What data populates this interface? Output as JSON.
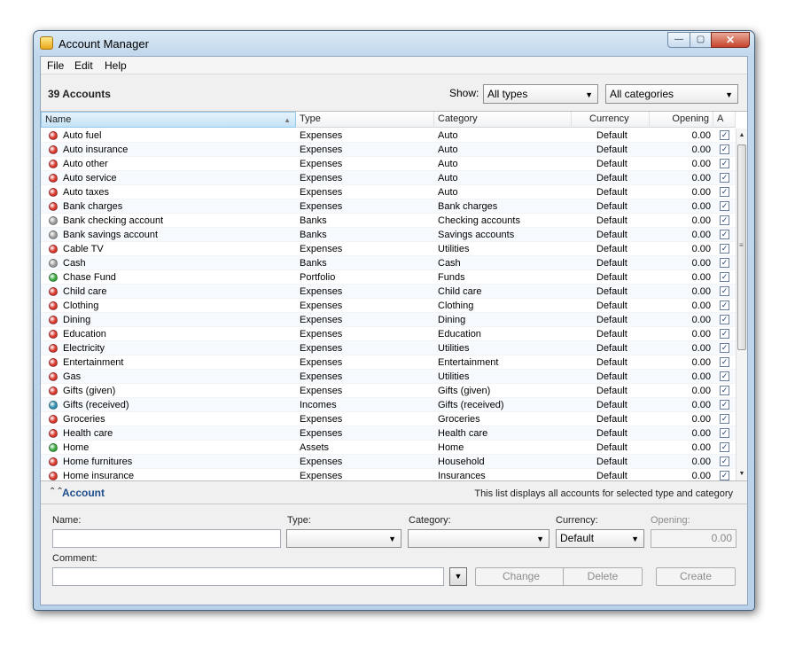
{
  "window": {
    "title": "Account Manager",
    "minimize": "—",
    "maximize": "▢",
    "close": "✕"
  },
  "menu": [
    "File",
    "Edit",
    "Help"
  ],
  "toolbar": {
    "accounts_count": "39 Accounts",
    "show_label": "Show:",
    "type_filter": "All types",
    "category_filter": "All categories"
  },
  "columns": {
    "name": "Name",
    "type": "Type",
    "category": "Category",
    "currency": "Currency",
    "opening": "Opening",
    "active": "A"
  },
  "status_colors": {
    "red": "#d9342c",
    "gray": "#9c9c9c",
    "green": "#35a83c",
    "teal": "#2c8fb0"
  },
  "accounts": [
    {
      "name": "Auto fuel",
      "type": "Expenses",
      "category": "Auto",
      "currency": "Default",
      "opening": "0.00",
      "status": "red"
    },
    {
      "name": "Auto insurance",
      "type": "Expenses",
      "category": "Auto",
      "currency": "Default",
      "opening": "0.00",
      "status": "red"
    },
    {
      "name": "Auto other",
      "type": "Expenses",
      "category": "Auto",
      "currency": "Default",
      "opening": "0.00",
      "status": "red"
    },
    {
      "name": "Auto service",
      "type": "Expenses",
      "category": "Auto",
      "currency": "Default",
      "opening": "0.00",
      "status": "red"
    },
    {
      "name": "Auto taxes",
      "type": "Expenses",
      "category": "Auto",
      "currency": "Default",
      "opening": "0.00",
      "status": "red"
    },
    {
      "name": "Bank charges",
      "type": "Expenses",
      "category": "Bank charges",
      "currency": "Default",
      "opening": "0.00",
      "status": "red"
    },
    {
      "name": "Bank checking account",
      "type": "Banks",
      "category": "Checking accounts",
      "currency": "Default",
      "opening": "0.00",
      "status": "gray"
    },
    {
      "name": "Bank savings account",
      "type": "Banks",
      "category": "Savings accounts",
      "currency": "Default",
      "opening": "0.00",
      "status": "gray"
    },
    {
      "name": "Cable TV",
      "type": "Expenses",
      "category": "Utilities",
      "currency": "Default",
      "opening": "0.00",
      "status": "red"
    },
    {
      "name": "Cash",
      "type": "Banks",
      "category": "Cash",
      "currency": "Default",
      "opening": "0.00",
      "status": "gray"
    },
    {
      "name": "Chase Fund",
      "type": "Portfolio",
      "category": "Funds",
      "currency": "Default",
      "opening": "0.00",
      "status": "green"
    },
    {
      "name": "Child care",
      "type": "Expenses",
      "category": "Child care",
      "currency": "Default",
      "opening": "0.00",
      "status": "red"
    },
    {
      "name": "Clothing",
      "type": "Expenses",
      "category": "Clothing",
      "currency": "Default",
      "opening": "0.00",
      "status": "red"
    },
    {
      "name": "Dining",
      "type": "Expenses",
      "category": "Dining",
      "currency": "Default",
      "opening": "0.00",
      "status": "red"
    },
    {
      "name": "Education",
      "type": "Expenses",
      "category": "Education",
      "currency": "Default",
      "opening": "0.00",
      "status": "red"
    },
    {
      "name": "Electricity",
      "type": "Expenses",
      "category": "Utilities",
      "currency": "Default",
      "opening": "0.00",
      "status": "red"
    },
    {
      "name": "Entertainment",
      "type": "Expenses",
      "category": "Entertainment",
      "currency": "Default",
      "opening": "0.00",
      "status": "red"
    },
    {
      "name": "Gas",
      "type": "Expenses",
      "category": "Utilities",
      "currency": "Default",
      "opening": "0.00",
      "status": "red"
    },
    {
      "name": "Gifts (given)",
      "type": "Expenses",
      "category": "Gifts (given)",
      "currency": "Default",
      "opening": "0.00",
      "status": "red"
    },
    {
      "name": "Gifts (received)",
      "type": "Incomes",
      "category": "Gifts (received)",
      "currency": "Default",
      "opening": "0.00",
      "status": "teal"
    },
    {
      "name": "Groceries",
      "type": "Expenses",
      "category": "Groceries",
      "currency": "Default",
      "opening": "0.00",
      "status": "red"
    },
    {
      "name": "Health care",
      "type": "Expenses",
      "category": "Health care",
      "currency": "Default",
      "opening": "0.00",
      "status": "red"
    },
    {
      "name": "Home",
      "type": "Assets",
      "category": "Home",
      "currency": "Default",
      "opening": "0.00",
      "status": "green"
    },
    {
      "name": "Home furnitures",
      "type": "Expenses",
      "category": "Household",
      "currency": "Default",
      "opening": "0.00",
      "status": "red"
    },
    {
      "name": "Home insurance",
      "type": "Expenses",
      "category": "Insurances",
      "currency": "Default",
      "opening": "0.00",
      "status": "red"
    }
  ],
  "panel": {
    "title": "Account",
    "hint": "This list displays all accounts for selected type and category"
  },
  "form": {
    "name_label": "Name:",
    "name_value": "",
    "type_label": "Type:",
    "type_value": "",
    "category_label": "Category:",
    "category_value": "",
    "currency_label": "Currency:",
    "currency_value": "Default",
    "opening_label": "Opening:",
    "opening_value": "0.00",
    "comment_label": "Comment:",
    "comment_value": ""
  },
  "buttons": {
    "change": "Change",
    "delete": "Delete",
    "create": "Create"
  },
  "icons": {
    "dropdown_arrow": "▼",
    "check": "✓",
    "sort_up": "▲",
    "collapse": "⌃⌃",
    "scroll_up": "▲",
    "scroll_down": "▼",
    "grip": "≡"
  }
}
